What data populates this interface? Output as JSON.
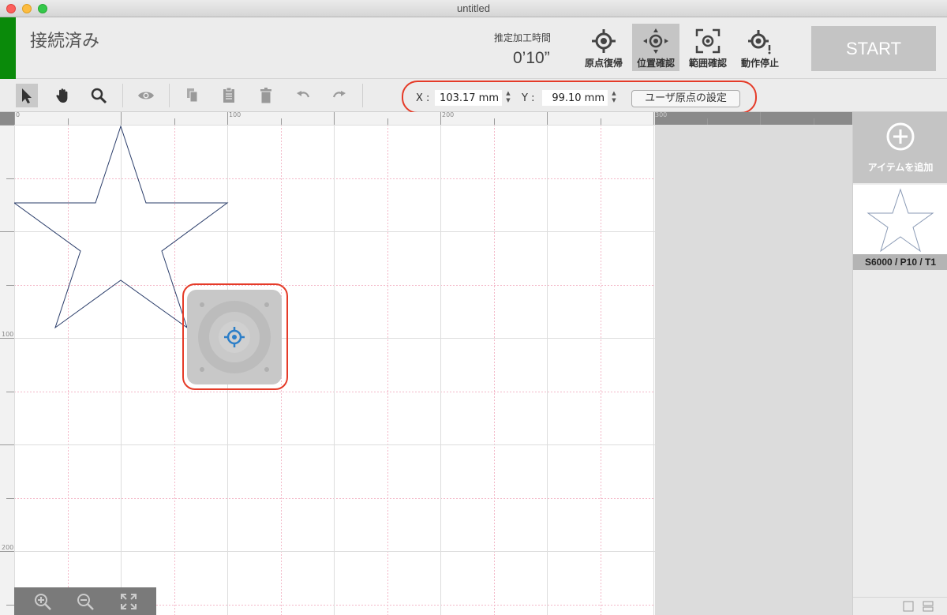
{
  "window": {
    "title": "untitled"
  },
  "header": {
    "status": "接続済み",
    "time_label": "推定加工時間",
    "time_value": "0’10”",
    "buttons": [
      {
        "label": "原点復帰",
        "icon": "crosshair-home-icon"
      },
      {
        "label": "位置確認",
        "icon": "crosshair-move-icon"
      },
      {
        "label": "範囲確認",
        "icon": "frame-crosshair-icon"
      },
      {
        "label": "動作停止",
        "icon": "crosshair-stop-icon"
      }
    ],
    "start": "START",
    "colors": {
      "status": "#0a8a0a",
      "start_bg": "#c4c4c4",
      "highlight": "#e53b28"
    }
  },
  "toolbar": {
    "tools": [
      "select-arrow-icon",
      "hand-icon",
      "search-icon",
      "eye-icon",
      "copy-icon",
      "paste-icon",
      "trash-icon",
      "undo-icon",
      "redo-icon"
    ],
    "x_label": "X :",
    "x_value": "103.17 mm",
    "y_label": "Y :",
    "y_value": "99.10 mm",
    "set_origin": "ユーザ原点の設定"
  },
  "rulers": {
    "top": [
      "0",
      "100",
      "200",
      "300"
    ],
    "left": [
      "100",
      "200"
    ]
  },
  "panel": {
    "add_item": "アイテムを追加",
    "items": [
      {
        "caption": "S6000 / P10 / T1",
        "shape": "star"
      }
    ]
  }
}
